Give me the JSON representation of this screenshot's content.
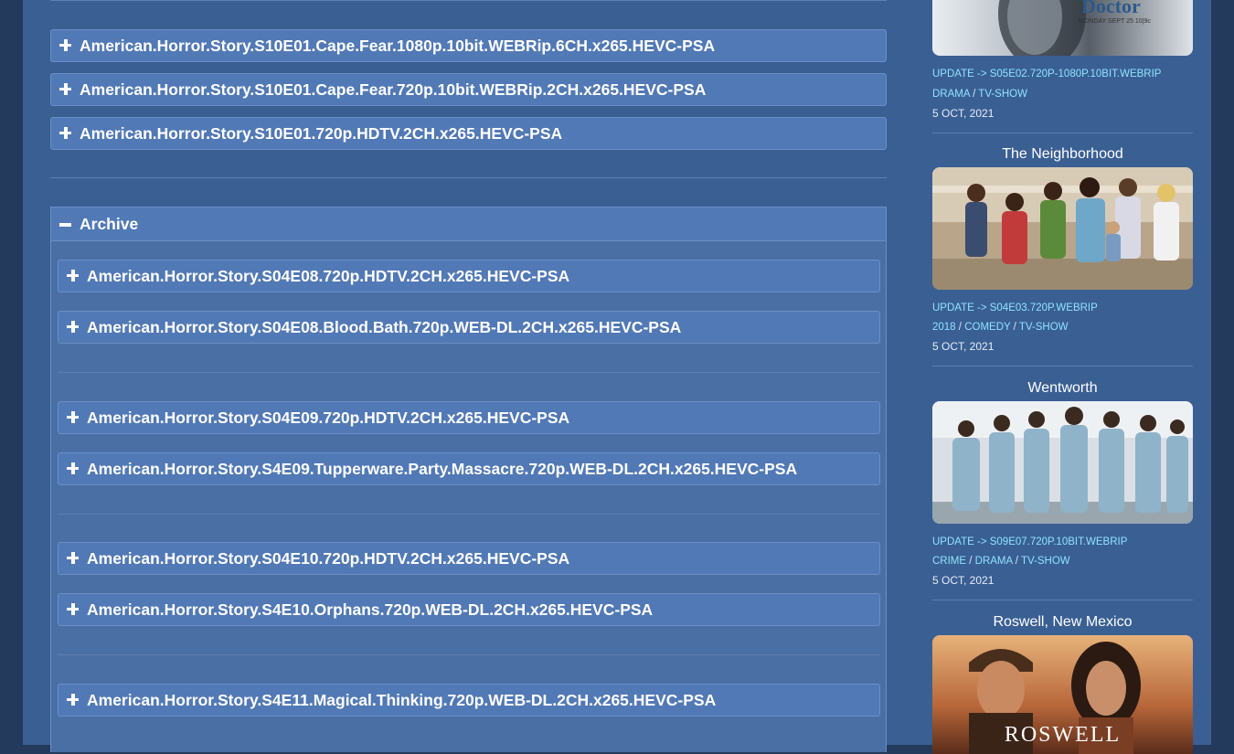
{
  "top_releases": [
    "American.Horror.Story.S10E01.Cape.Fear.1080p.10bit.WEBRip.6CH.x265.HEVC-PSA",
    "American.Horror.Story.S10E01.Cape.Fear.720p.10bit.WEBRip.2CH.x265.HEVC-PSA",
    "American.Horror.Story.S10E01.720p.HDTV.2CH.x265.HEVC-PSA"
  ],
  "archive": {
    "title": "Archive",
    "items": [
      "American.Horror.Story.S04E08.720p.HDTV.2CH.x265.HEVC-PSA",
      "American.Horror.Story.S04E08.Blood.Bath.720p.WEB-DL.2CH.x265.HEVC-PSA",
      "American.Horror.Story.S04E09.720p.HDTV.2CH.x265.HEVC-PSA",
      "American.Horror.Story.S4E09.Tupperware.Party.Massacre.720p.WEB-DL.2CH.x265.HEVC-PSA",
      "American.Horror.Story.S04E10.720p.HDTV.2CH.x265.HEVC-PSA",
      "American.Horror.Story.S4E10.Orphans.720p.WEB-DL.2CH.x265.HEVC-PSA",
      "American.Horror.Story.S4E11.Magical.Thinking.720p.WEB-DL.2CH.x265.HEVC-PSA"
    ]
  },
  "sidebar": {
    "good_doctor": {
      "poster_text": "Doctor",
      "poster_sub": "MONDAY SEPT 25 10|9c",
      "update": "UPDATE -> S05E02.720P-1080P.10BIT.WEBRIP",
      "tags": [
        "DRAMA",
        "TV-SHOW"
      ],
      "date": "5 OCT, 2021"
    },
    "neighborhood": {
      "title": "The Neighborhood",
      "update": "UPDATE -> S04E03.720P.WEBRIP",
      "tags": [
        "2018",
        "COMEDY",
        "TV-SHOW"
      ],
      "date": "5 OCT, 2021"
    },
    "wentworth": {
      "title": "Wentworth",
      "update": "UPDATE -> S09E07.720P.10BIT.WEBRIP",
      "tags": [
        "CRIME",
        "DRAMA",
        "TV-SHOW"
      ],
      "date": "5 OCT, 2021"
    },
    "roswell": {
      "title": "Roswell, New Mexico",
      "poster_text": "ROSWELL"
    }
  }
}
